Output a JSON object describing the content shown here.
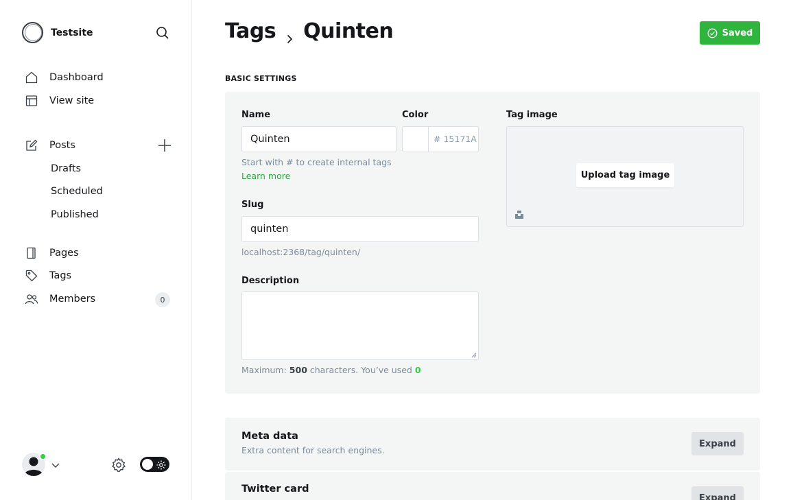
{
  "app": {
    "site_name": "Testsite"
  },
  "sidebar": {
    "items": [
      {
        "label": "Dashboard",
        "icon": "home-icon"
      },
      {
        "label": "View site",
        "icon": "layout-icon"
      },
      {
        "label": "Posts",
        "icon": "edit-icon"
      },
      {
        "label": "Drafts"
      },
      {
        "label": "Scheduled"
      },
      {
        "label": "Published"
      },
      {
        "label": "Pages",
        "icon": "page-icon"
      },
      {
        "label": "Tags",
        "icon": "tag-icon"
      },
      {
        "label": "Members",
        "icon": "members-icon",
        "count": "0"
      }
    ]
  },
  "header": {
    "breadcrumb_parent": "Tags",
    "breadcrumb_current": "Quinten",
    "saved_label": "Saved"
  },
  "basic": {
    "section_title": "BASIC SETTINGS",
    "name_label": "Name",
    "name_value": "Quinten",
    "name_hint": "Start with # to create internal tags",
    "learn_more": "Learn more",
    "color_label": "Color",
    "color_hash": "#",
    "color_value": "15171A",
    "slug_label": "Slug",
    "slug_value": "quinten",
    "slug_url": "localhost:2368/tag/quinten/",
    "description_label": "Description",
    "max_prefix": "Maximum:",
    "max_count": "500",
    "max_middle": "characters. You’ve used",
    "used_count": "0",
    "tag_image_label": "Tag image",
    "upload_label": "Upload tag image"
  },
  "cards": [
    {
      "title": "Meta data",
      "desc": "Extra content for search engines.",
      "button": "Expand"
    },
    {
      "title": "Twitter card",
      "desc": "",
      "button": "Expand"
    }
  ],
  "colors": {
    "accent_green": "#30cf43",
    "saved_green": "#2fb53e",
    "panel_bg": "#f4f5f5"
  }
}
